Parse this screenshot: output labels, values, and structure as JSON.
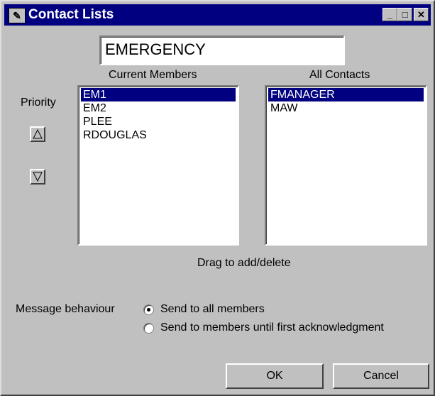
{
  "window": {
    "title": "Contact Lists",
    "title_icon": "contact-lists-app-icon",
    "buttons": {
      "minimize": "_",
      "maximize": "□",
      "close": "✕"
    }
  },
  "list_name": {
    "value": "EMERGENCY"
  },
  "current_members": {
    "label": "Current Members",
    "items": [
      "EM1",
      "EM2",
      "PLEE",
      "RDOUGLAS"
    ],
    "selected_index": 0
  },
  "all_contacts": {
    "label": "All Contacts",
    "items": [
      "FMANAGER",
      "MAW"
    ],
    "selected_index": 0
  },
  "priority": {
    "label": "Priority",
    "up_icon": "triangle-up-icon",
    "down_icon": "triangle-down-icon"
  },
  "hint": "Drag to add/delete",
  "message_behaviour": {
    "label": "Message behaviour",
    "options": [
      "Send to all members",
      "Send to members until first acknowledgment"
    ],
    "selected_index": 0
  },
  "buttons": {
    "ok": "OK",
    "cancel": "Cancel"
  },
  "colors": {
    "titlebar": "#000080",
    "face": "#c0c0c0",
    "selection": "#000080"
  }
}
